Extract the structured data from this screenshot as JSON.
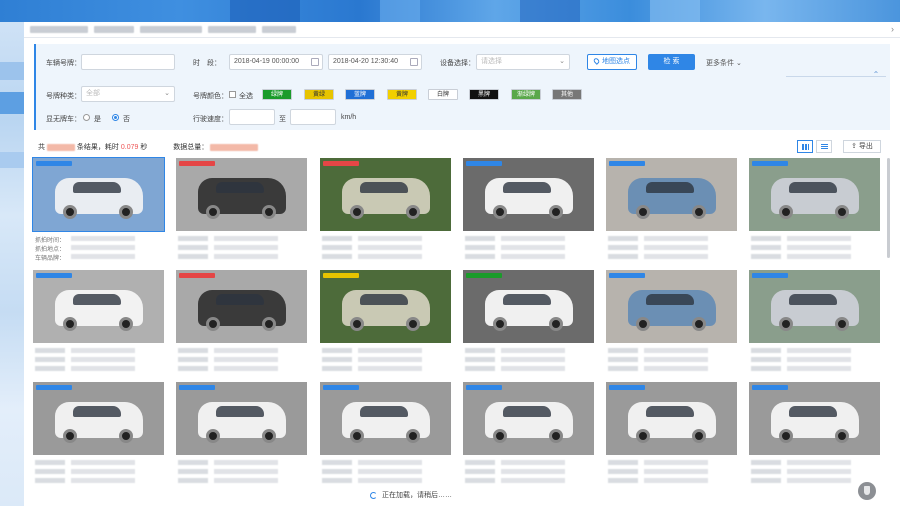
{
  "filters": {
    "plate_label": "车辆号牌：",
    "plate_value": "",
    "time_label": "时　段：",
    "time_start": "2018-04-19  00:00:00",
    "time_end": "2018-04-20  12:30:40",
    "device_label": "设备选择：",
    "device_placeholder": "请选择",
    "map_button": "地图选点",
    "search_button": "检 索",
    "more_label": "更多条件",
    "plate_type_label": "号牌种类：",
    "plate_type_value": "全部",
    "plate_color_label": "号牌颜色：",
    "select_all_label": "全选",
    "colors": [
      {
        "label": "绿牌",
        "bg": "#1a9b2a",
        "fg": "#ffffff"
      },
      {
        "label": "黄绿",
        "bg": "#e7c400",
        "fg": "#333333"
      },
      {
        "label": "蓝牌",
        "bg": "#1f6fd6",
        "fg": "#ffffff"
      },
      {
        "label": "黄牌",
        "bg": "#f2d000",
        "fg": "#333333"
      },
      {
        "label": "白牌",
        "bg": "#ffffff",
        "fg": "#333333"
      },
      {
        "label": "黑牌",
        "bg": "#111111",
        "fg": "#ffffff"
      },
      {
        "label": "渐绿牌",
        "bg": "#5aa84a",
        "fg": "#ffffff"
      },
      {
        "label": "其他",
        "bg": "#777777",
        "fg": "#ffffff"
      }
    ],
    "unplated_label": "显无牌车：",
    "yes_label": "是",
    "no_label": "否",
    "speed_label": "行驶速度：",
    "speed_to": "至",
    "speed_unit": "km/h"
  },
  "summary": {
    "prefix": "共",
    "mid": "条结果，耗时",
    "time": "0.079",
    "unit": "秒",
    "total_label": "数据总量："
  },
  "toolbar": {
    "export_label": "导出"
  },
  "first_card": {
    "line1": "抓拍时间：",
    "line2": "抓拍地点：",
    "line3": "车辆品牌："
  },
  "loading_text": "正在加载，请稍后……",
  "accent_color": "#2f86e6"
}
